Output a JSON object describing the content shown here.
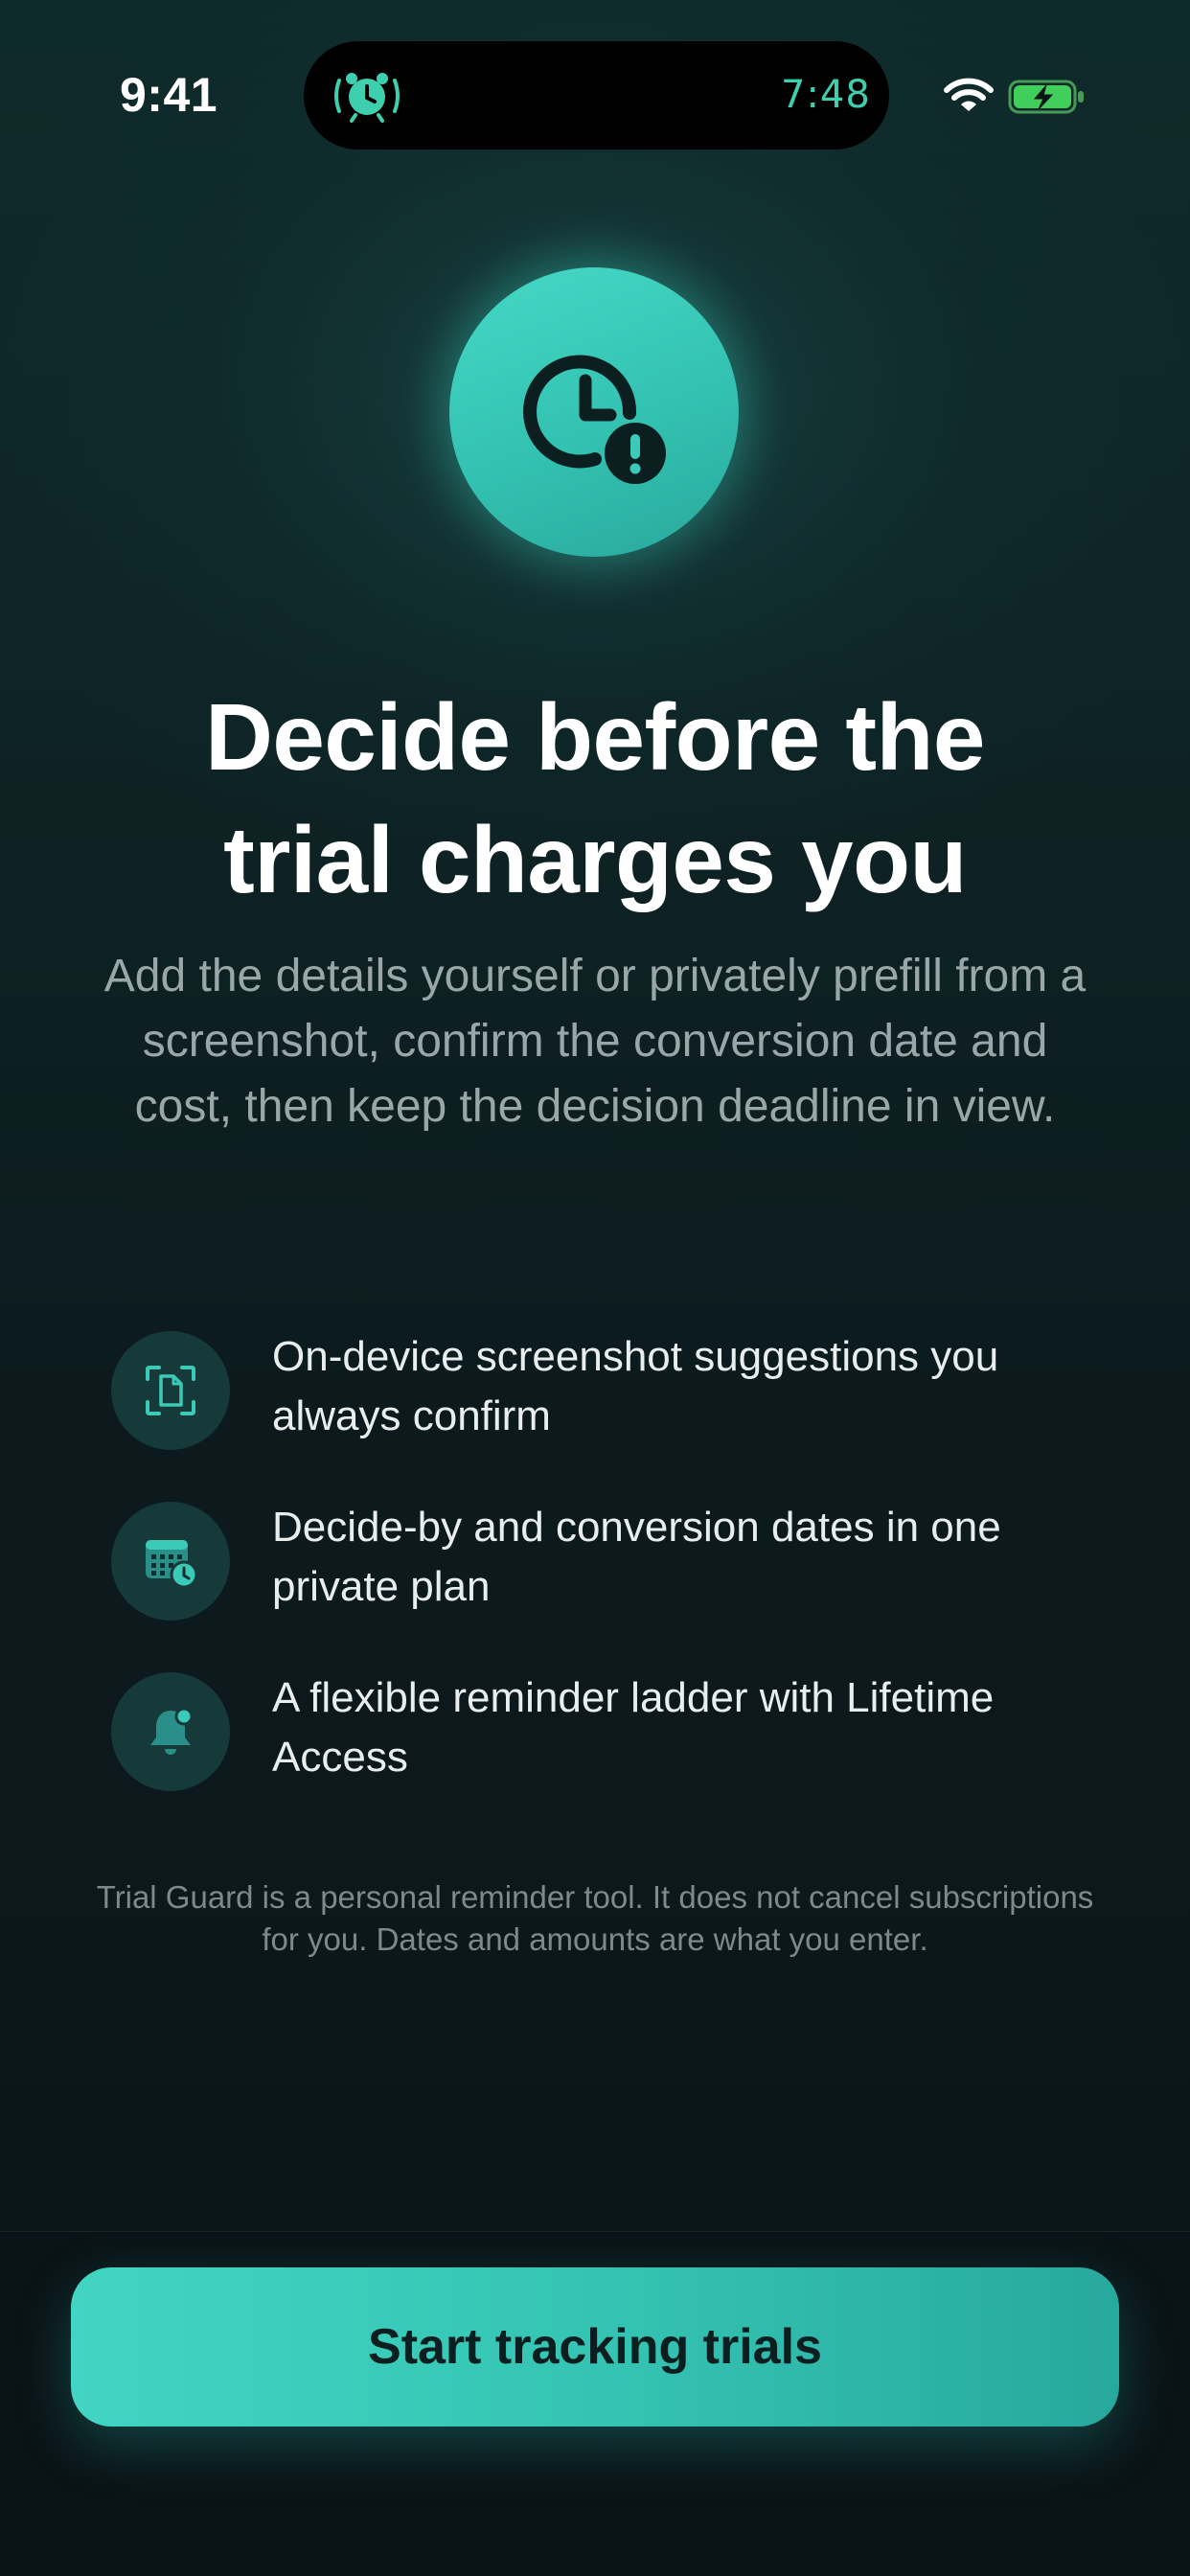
{
  "status_bar": {
    "time": "9:41",
    "live_activity_time": "7:48",
    "live_activity_icon": "alarm-clock-icon",
    "wifi_icon": "wifi-icon",
    "battery_icon": "battery-charging-icon",
    "accent_color": "#3ecfae"
  },
  "hero": {
    "icon": "clock-alert-icon",
    "circle_color": "#3ccab8"
  },
  "headline": {
    "line1": "Decide before the",
    "line2": "trial charges you"
  },
  "subtitle": "Add the details yourself or privately prefill from a screenshot, confirm the conversion date and cost, then keep the decision deadline in view.",
  "features": [
    {
      "icon": "document-scan-icon",
      "text": "On-device screenshot suggestions you always confirm"
    },
    {
      "icon": "calendar-clock-icon",
      "text": "Decide-by and conversion dates in one private plan"
    },
    {
      "icon": "bell-badge-icon",
      "text": "A flexible reminder ladder with Lifetime Access"
    }
  ],
  "disclaimer": "Trial Guard is a personal reminder tool. It does not cancel subscriptions for you. Dates and amounts are what you enter.",
  "cta": {
    "label": "Start tracking trials",
    "color": "#3ccab8"
  }
}
